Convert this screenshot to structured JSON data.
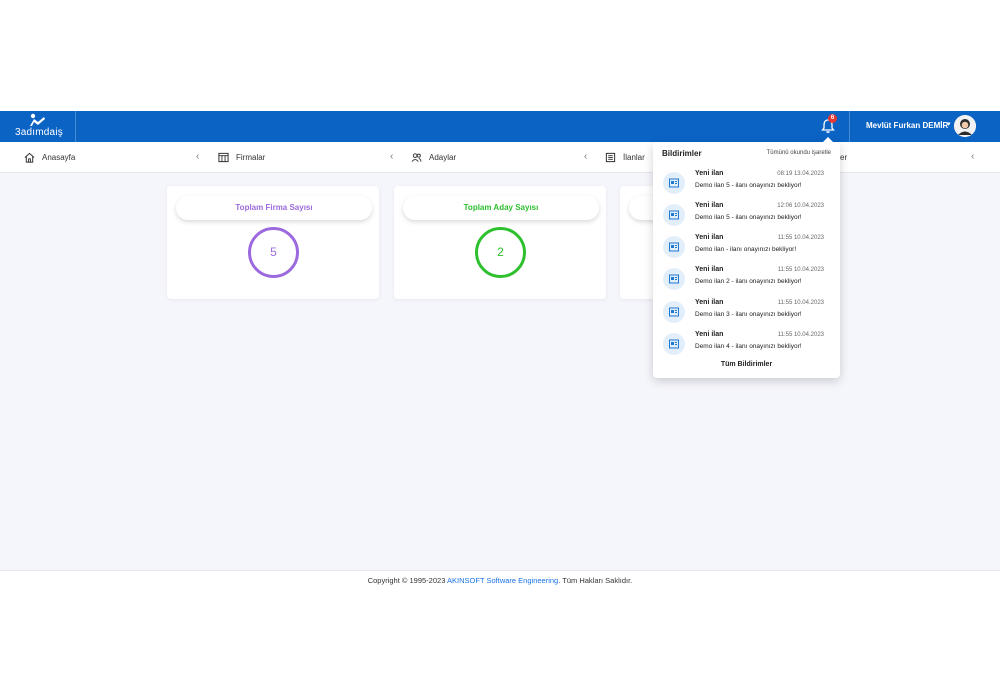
{
  "header": {
    "logo_text": "3adımdaiş",
    "notification_count": "6",
    "user_name": "Mevlüt Furkan DEMİR",
    "brand_color": "#0b63c4"
  },
  "nav": {
    "items": [
      {
        "label": "Anasayfa",
        "icon": "home-icon"
      },
      {
        "label": "Firmalar",
        "icon": "table-icon"
      },
      {
        "label": "Adaylar",
        "icon": "users-icon"
      },
      {
        "label": "İlanlar",
        "icon": "list-icon"
      },
      {
        "label": "er",
        "icon": ""
      }
    ]
  },
  "cards": [
    {
      "title": "Toplam Firma Sayısı",
      "value": "5",
      "color": "#9c6ade"
    },
    {
      "title": "Toplam Aday Sayısı",
      "value": "2",
      "color": "#2ec02e"
    }
  ],
  "notifications": {
    "title": "Bildirimler",
    "mark_all": "Tümünü okundu işaretle",
    "view_all": "Tüm Bildirimler",
    "items": [
      {
        "title": "Yeni ilan",
        "time": "08:19 13.04.2023",
        "message": "Demo ilan 5 - ilanı onayınızı bekliyor!"
      },
      {
        "title": "Yeni ilan",
        "time": "12:06 10.04.2023",
        "message": "Demo ilan 5 - ilanı onayınızı bekliyor!"
      },
      {
        "title": "Yeni ilan",
        "time": "11:55 10.04.2023",
        "message": "Demo ilan - ilanı onayınızı bekliyor!"
      },
      {
        "title": "Yeni ilan",
        "time": "11:55 10.04.2023",
        "message": "Demo ilan 2 - ilanı onayınızı bekliyor!"
      },
      {
        "title": "Yeni ilan",
        "time": "11:55 10.04.2023",
        "message": "Demo ilan 3 - ilanı onayınızı bekliyor!"
      },
      {
        "title": "Yeni ilan",
        "time": "11:55 10.04.2023",
        "message": "Demo ilan 4 - ilanı onayınızı bekliyor!"
      }
    ]
  },
  "footer": {
    "prefix": "Copyright © 1995-2023 ",
    "link": "AKINSOFT Software Engineering",
    "suffix": ". Tüm Hakları Saklıdır."
  }
}
